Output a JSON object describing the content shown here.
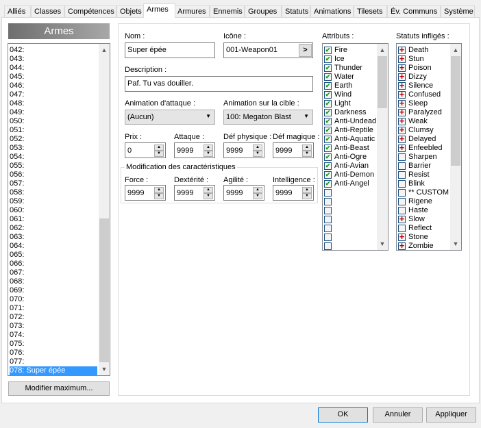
{
  "tabs": [
    "Alliés",
    "Classes",
    "Compétences",
    "Objets",
    "Armes",
    "Armures",
    "Ennemis",
    "Groupes",
    "Statuts",
    "Animations",
    "Tilesets",
    "Év. Communs",
    "Système"
  ],
  "active_tab": "Armes",
  "list": {
    "title": "Armes",
    "items": [
      "042:",
      "043:",
      "044:",
      "045:",
      "046:",
      "047:",
      "048:",
      "049:",
      "050:",
      "051:",
      "052:",
      "053:",
      "054:",
      "055:",
      "056:",
      "057:",
      "058:",
      "059:",
      "060:",
      "061:",
      "062:",
      "063:",
      "064:",
      "065:",
      "066:",
      "067:",
      "068:",
      "069:",
      "070:",
      "071:",
      "072:",
      "073:",
      "074:",
      "075:",
      "076:",
      "077:",
      "078: Super épée"
    ],
    "selected": "078: Super épée",
    "max_button": "Modifier maximum..."
  },
  "form": {
    "name_label": "Nom :",
    "name": "Super épée",
    "icon_label": "Icône :",
    "icon": "001-Weapon01",
    "icon_button": ">",
    "desc_label": "Description :",
    "desc": "Paf. Tu vas douiller.",
    "anim_attack_label": "Animation d'attaque :",
    "anim_attack": "(Aucun)",
    "anim_target_label": "Animation sur la cible :",
    "anim_target": "100: Megaton Blast",
    "price_label": "Prix :",
    "price": "0",
    "atk_label": "Attaque :",
    "atk": "9999",
    "pdef_label": "Déf physique :",
    "pdef": "9999",
    "mdef_label": "Déf magique :",
    "mdef": "9999",
    "group_label": "Modification des caractéristiques",
    "str_label": "Force :",
    "str": "9999",
    "dex_label": "Dextérité :",
    "dex": "9999",
    "agi_label": "Agilité :",
    "agi": "9999",
    "int_label": "Intelligence :",
    "int": "9999"
  },
  "attributes": {
    "label": "Attributs :",
    "items": [
      {
        "name": "Fire",
        "checked": true
      },
      {
        "name": "Ice",
        "checked": true
      },
      {
        "name": "Thunder",
        "checked": true
      },
      {
        "name": "Water",
        "checked": true
      },
      {
        "name": "Earth",
        "checked": true
      },
      {
        "name": "Wind",
        "checked": true
      },
      {
        "name": "Light",
        "checked": true
      },
      {
        "name": "Darkness",
        "checked": true
      },
      {
        "name": "Anti-Undead",
        "checked": true
      },
      {
        "name": "Anti-Reptile",
        "checked": true
      },
      {
        "name": "Anti-Aquatic",
        "checked": true
      },
      {
        "name": "Anti-Beast",
        "checked": true
      },
      {
        "name": "Anti-Ogre",
        "checked": true
      },
      {
        "name": "Anti-Avian",
        "checked": true
      },
      {
        "name": "Anti-Demon",
        "checked": true
      },
      {
        "name": "Anti-Angel",
        "checked": true
      },
      {
        "name": "",
        "checked": false
      },
      {
        "name": "",
        "checked": false
      },
      {
        "name": "",
        "checked": false
      },
      {
        "name": "",
        "checked": false
      },
      {
        "name": "",
        "checked": false
      },
      {
        "name": "",
        "checked": false
      },
      {
        "name": "",
        "checked": false
      }
    ]
  },
  "states": {
    "label": "Statuts infligés :",
    "items": [
      {
        "name": "Death",
        "plus": true
      },
      {
        "name": "Stun",
        "plus": true
      },
      {
        "name": "Poison",
        "plus": true
      },
      {
        "name": "Dizzy",
        "plus": true
      },
      {
        "name": "Silence",
        "plus": true
      },
      {
        "name": "Confused",
        "plus": true
      },
      {
        "name": "Sleep",
        "plus": true
      },
      {
        "name": "Paralyzed",
        "plus": true
      },
      {
        "name": "Weak",
        "plus": true
      },
      {
        "name": "Clumsy",
        "plus": true
      },
      {
        "name": "Delayed",
        "plus": true
      },
      {
        "name": "Enfeebled",
        "plus": true
      },
      {
        "name": "Sharpen",
        "plus": false
      },
      {
        "name": "Barrier",
        "plus": false
      },
      {
        "name": "Resist",
        "plus": false
      },
      {
        "name": "Blink",
        "plus": false
      },
      {
        "name": "** CUSTOM",
        "plus": false
      },
      {
        "name": "Rigene",
        "plus": false
      },
      {
        "name": "Haste",
        "plus": false
      },
      {
        "name": "Slow",
        "plus": true
      },
      {
        "name": "Reflect",
        "plus": false
      },
      {
        "name": "Stone",
        "plus": true
      },
      {
        "name": "Zombie",
        "plus": true
      }
    ]
  },
  "buttons": {
    "ok": "OK",
    "cancel": "Annuler",
    "apply": "Appliquer"
  }
}
